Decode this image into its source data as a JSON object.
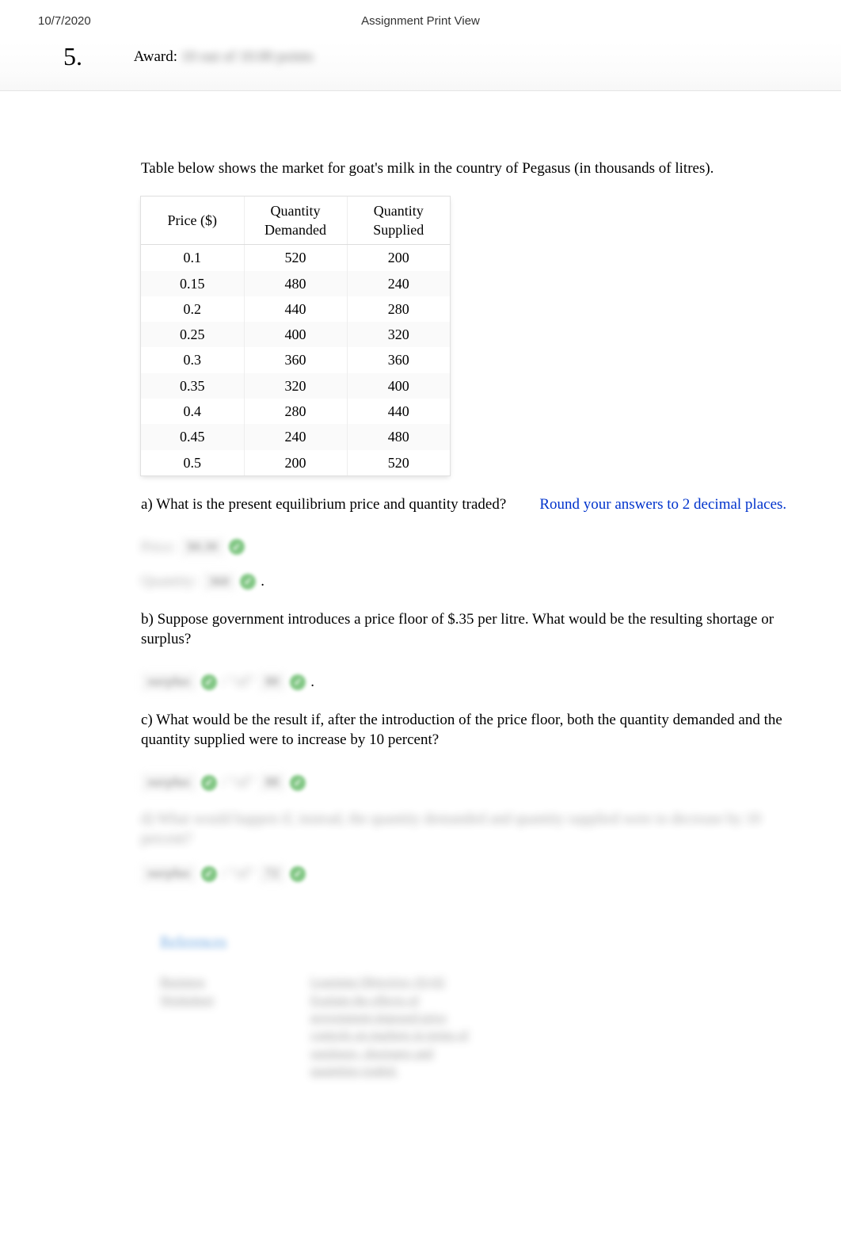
{
  "header": {
    "date": "10/7/2020",
    "title": "Assignment Print View"
  },
  "question": {
    "number": "5.",
    "award_label": "Award:",
    "award_value_blurred": "10 out of 10.00 points"
  },
  "intro": "Table below shows the market for goat's milk in the country of Pegasus (in thousands of litres).",
  "table": {
    "headers": [
      "Price ($)",
      "Quantity Demanded",
      "Quantity Supplied"
    ],
    "rows": [
      [
        "0.1",
        "520",
        "200"
      ],
      [
        "0.15",
        "480",
        "240"
      ],
      [
        "0.2",
        "440",
        "280"
      ],
      [
        "0.25",
        "400",
        "320"
      ],
      [
        "0.3",
        "360",
        "360"
      ],
      [
        "0.35",
        "320",
        "400"
      ],
      [
        "0.4",
        "280",
        "440"
      ],
      [
        "0.45",
        "240",
        "480"
      ],
      [
        "0.5",
        "200",
        "520"
      ]
    ]
  },
  "parts": {
    "a": {
      "text": "a) What is the present equilibrium price and quantity traded?",
      "hint": "Round your answers to 2 decimal places.",
      "answers": [
        {
          "label_blurred": "Price:",
          "value_blurred": "$0.30"
        },
        {
          "label_blurred": "Quantity:",
          "value_blurred": "360"
        }
      ],
      "trailing_period": "."
    },
    "b": {
      "text": "b) Suppose government introduces a price floor of $.35 per litre. What would be the resulting shortage or surplus?",
      "answer": {
        "label_blurred": "surplus",
        "value_mid": "/ \"of\"",
        "value2_blurred": "80"
      },
      "trailing_period": "."
    },
    "c": {
      "text": "c) What would be the result if, after the introduction of the price floor, both the quantity demanded and the quantity supplied were to increase by 10 percent?",
      "answer": {
        "label_blurred": "surplus",
        "value_mid": "/ \"of\"",
        "value2_blurred": "88"
      }
    },
    "d": {
      "text_blurred": "d) What would happen if, instead, the quantity demanded and quantity supplied were to decrease by 10 percent?",
      "answer": {
        "label_blurred": "surplus",
        "value_mid": "/ \"of\"",
        "value2_blurred": "72"
      }
    }
  },
  "references": {
    "title_blurred": "References",
    "left_blurred": "Business Worksheet",
    "right_blurred": "Learning Objective: 03-02 Explain the effects of government-imposed price controls on markets in terms of surpluses, shortages and quantities traded."
  }
}
